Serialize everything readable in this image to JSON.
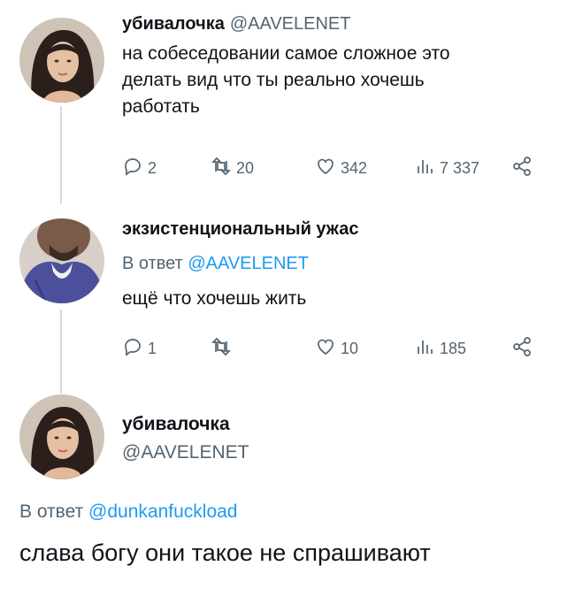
{
  "tweets": [
    {
      "display_name": "убивалочка",
      "handle": "@AAVELENET",
      "text_lines": [
        "на собеседовании самое сложное это",
        "делать вид что ты реально хочешь",
        "работать"
      ],
      "actions": {
        "replies": "2",
        "retweets": "20",
        "likes": "342",
        "views": "7 337"
      }
    },
    {
      "display_name": "экзистенциональный ужас",
      "reply_prefix": "В ответ",
      "reply_to": "@AAVELENET",
      "text": "ещё что хочешь жить",
      "actions": {
        "replies": "1",
        "retweets": "",
        "likes": "10",
        "views": "185"
      }
    },
    {
      "display_name": "убивалочка",
      "handle": "@AAVELENET",
      "reply_prefix": "В ответ",
      "reply_to": "@dunkanfuckload",
      "text": "слава богу они такое не спрашивают"
    }
  ],
  "icons": [
    "reply-icon",
    "retweet-icon",
    "like-icon",
    "views-icon",
    "share-icon"
  ],
  "colors": {
    "text": "#0f1419",
    "secondary": "#536471",
    "link": "#1d9bf0",
    "thread_line": "#cfd9de"
  }
}
